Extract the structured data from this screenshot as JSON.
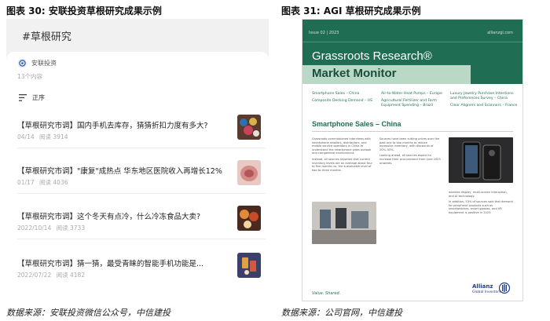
{
  "figures": {
    "left_title": "图表 30: 安联投资草根研究成果示例",
    "right_title": "图表 31: AGI 草根研究成果示例",
    "left_source": "数据来源：安联投资微信公众号，中信建投",
    "right_source": "数据来源：公司官网，中信建投"
  },
  "wechat": {
    "topic": "#草根研究",
    "account": "安联投资",
    "count": "13个内容",
    "sort": "正序",
    "articles": [
      {
        "title": "【草根研究市调】国内手机去库存，猜猜折扣力度有多大?",
        "date": "04/14",
        "reads": "阅读 3914"
      },
      {
        "title": "【草根研究市调】\"康复\"成热点 华东地区医院收入再增长12%",
        "date": "01/17",
        "reads": "阅读 4036"
      },
      {
        "title": "【草根研究市调】这个冬天有点冷，什么冷冻食品大卖?",
        "date": "2022/10/14",
        "reads": "阅读 3733"
      },
      {
        "title": "【草根研究市调】猜一猜，最受青睐的智能手机功能是...",
        "date": "2022/07/22",
        "reads": "阅读 4182"
      }
    ]
  },
  "report": {
    "issue": "Issue 02 | 2023",
    "url": "allianzgi.com",
    "title_line1": "Grassroots Research®",
    "title_line2": "Market Monitor",
    "topics": [
      [
        "Smartphone Sales – China",
        "Composite Decking Demand – US"
      ],
      [
        "Air-to-Water Heat Pumps – Europe",
        "Agricultural Fertilizer and Farm Equipment Spending – Brazil"
      ],
      [
        "Luxury Jewelry Purchase Intentions and Preferences Survey – China",
        "Clear Aligners and Scanners – France"
      ]
    ],
    "section_title": "Smartphone Sales – China",
    "col1": [
      "Grassroots commissioned interviews with smartphone retailers, distributors, and mobile service operators in China to understand the smartphone sales outlook and competitive environment.",
      "Instead, all sources reported that current inventory levels are on average about four to five months vs. the sustainable level of two to three months."
    ],
    "col2": [
      "Sources have been cutting prices over the past one to two months to reduce excessive inventory, with discounts of 20%–50%.",
      "Looking ahead, all sources expect to increase their procurement from June 2023 onwards."
    ],
    "col3": [
      "wireless display, multi-screen interaction, and AI technology.",
      "In addition, 53% of sources said that demand for peripheral products such as smartwatches, smart glasses, and VR equipment is positive in 2023."
    ],
    "footer": "Value. Shared.",
    "logo": "Allianz",
    "logo_sub": "Global Investors"
  }
}
